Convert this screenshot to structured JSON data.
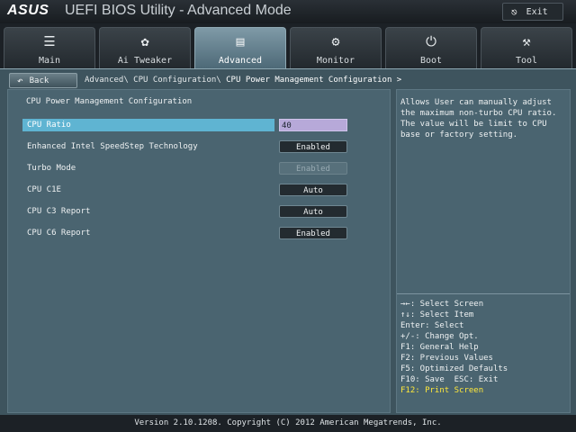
{
  "app": {
    "brand": "ASUS",
    "title": "UEFI BIOS Utility - Advanced Mode",
    "exit_label": "Exit"
  },
  "tabs": [
    {
      "label": "Main",
      "icon": "list-icon"
    },
    {
      "label": "Ai Tweaker",
      "icon": "fan-icon"
    },
    {
      "label": "Advanced",
      "icon": "monitor-info-icon",
      "active": true
    },
    {
      "label": "Monitor",
      "icon": "gauge-icon"
    },
    {
      "label": "Boot",
      "icon": "power-icon"
    },
    {
      "label": "Tool",
      "icon": "tool-icon"
    }
  ],
  "nav": {
    "back_label": "Back",
    "breadcrumb_prefix": "Advanced\\ CPU Configuration\\ ",
    "breadcrumb_current": "CPU Power Management Configuration >"
  },
  "section_title": "CPU Power Management Configuration",
  "settings": [
    {
      "label": "CPU Ratio",
      "value": "40",
      "kind": "input",
      "selected": true
    },
    {
      "label": "Enhanced Intel SpeedStep Technology",
      "value": "Enabled",
      "kind": "button"
    },
    {
      "label": "Turbo Mode",
      "value": "Enabled",
      "kind": "button",
      "disabled": true
    },
    {
      "label": "CPU C1E",
      "value": "Auto",
      "kind": "button"
    },
    {
      "label": "CPU C3 Report",
      "value": "Auto",
      "kind": "button"
    },
    {
      "label": "CPU C6 Report",
      "value": "Enabled",
      "kind": "button"
    }
  ],
  "help_text": "Allows User can manually adjust the maximum non-turbo CPU ratio. The value will be limit to CPU base or factory setting.",
  "key_help": [
    "→←: Select Screen",
    "↑↓: Select Item",
    "Enter: Select",
    "+/-: Change Opt.",
    "F1: General Help",
    "F2: Previous Values",
    "F5: Optimized Defaults",
    "F10: Save  ESC: Exit",
    "F12: Print Screen"
  ],
  "key_help_highlight": "F12: Print Screen",
  "footer": "Version 2.10.1208. Copyright (C) 2012 American Megatrends, Inc.",
  "colors": {
    "accent_tab": "#6f8c99",
    "selected_row": "#5fb4d2",
    "input_value": "#b7a9d9",
    "highlight_key": "#ffe83a"
  }
}
